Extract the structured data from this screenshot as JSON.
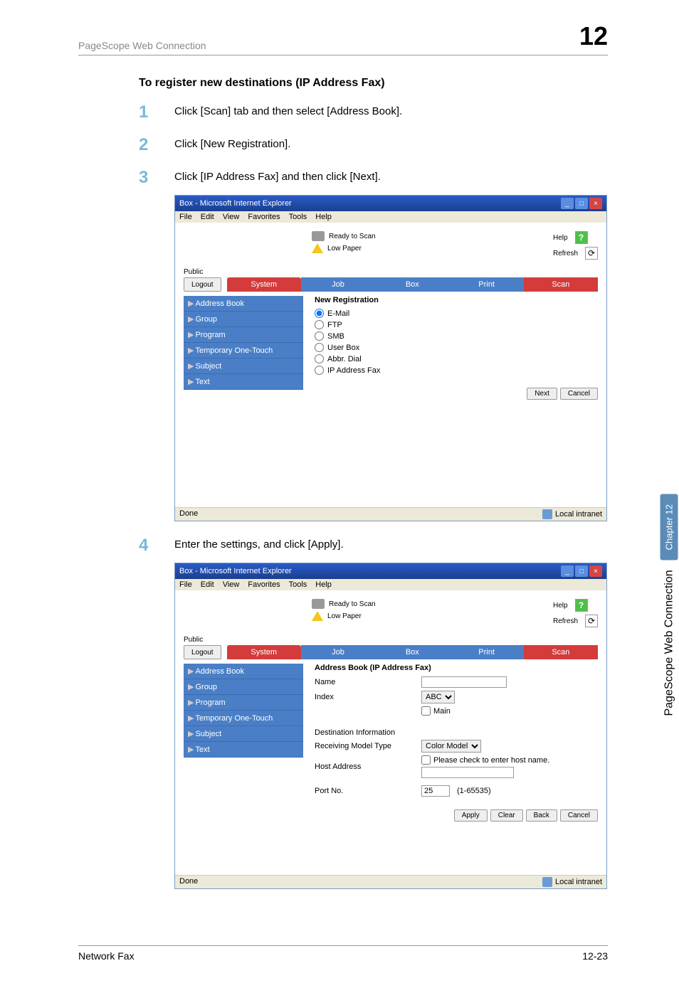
{
  "header": {
    "title": "PageScope Web Connection",
    "chapter": "12"
  },
  "section_title": "To register new destinations (IP Address Fax)",
  "steps": [
    {
      "num": "1",
      "text": "Click [Scan] tab and then select [Address Book]."
    },
    {
      "num": "2",
      "text": "Click [New Registration]."
    },
    {
      "num": "3",
      "text": "Click [IP Address Fax] and then click [Next]."
    },
    {
      "num": "4",
      "text": "Enter the settings, and click [Apply]."
    }
  ],
  "browser": {
    "title": "Box - Microsoft Internet Explorer",
    "menu": {
      "file": "File",
      "edit": "Edit",
      "view": "View",
      "favorites": "Favorites",
      "tools": "Tools",
      "help": "Help"
    },
    "status": {
      "ready": "Ready to Scan",
      "lowpaper": "Low Paper"
    },
    "help": "Help",
    "refresh": "Refresh",
    "public": "Public",
    "logout": "Logout",
    "tabs": {
      "system": "System",
      "job": "Job",
      "box": "Box",
      "print": "Print",
      "scan": "Scan"
    },
    "sidebar": [
      "Address Book",
      "Group",
      "Program",
      "Temporary One-Touch",
      "Subject",
      "Text"
    ],
    "statusbar": {
      "done": "Done",
      "zone": "Local intranet"
    }
  },
  "screen1": {
    "title": "New Registration",
    "options": [
      "E-Mail",
      "FTP",
      "SMB",
      "User Box",
      "Abbr. Dial",
      "IP Address Fax"
    ],
    "next": "Next",
    "cancel": "Cancel"
  },
  "screen2": {
    "title": "Address Book (IP Address Fax)",
    "name": "Name",
    "index": "Index",
    "index_val": "ABC",
    "main": "Main",
    "dest_info": "Destination Information",
    "recv_model": "Receiving Model Type",
    "recv_model_val": "Color Model",
    "host": "Host Address",
    "host_hint": "Please check to enter host name.",
    "port": "Port No.",
    "port_val": "25",
    "port_range": "(1-65535)",
    "apply": "Apply",
    "clear": "Clear",
    "back": "Back",
    "cancel": "Cancel"
  },
  "sidebar_right": {
    "chapter": "Chapter 12",
    "pagescope": "PageScope Web Connection"
  },
  "footer": {
    "left": "Network Fax",
    "right": "12-23"
  }
}
